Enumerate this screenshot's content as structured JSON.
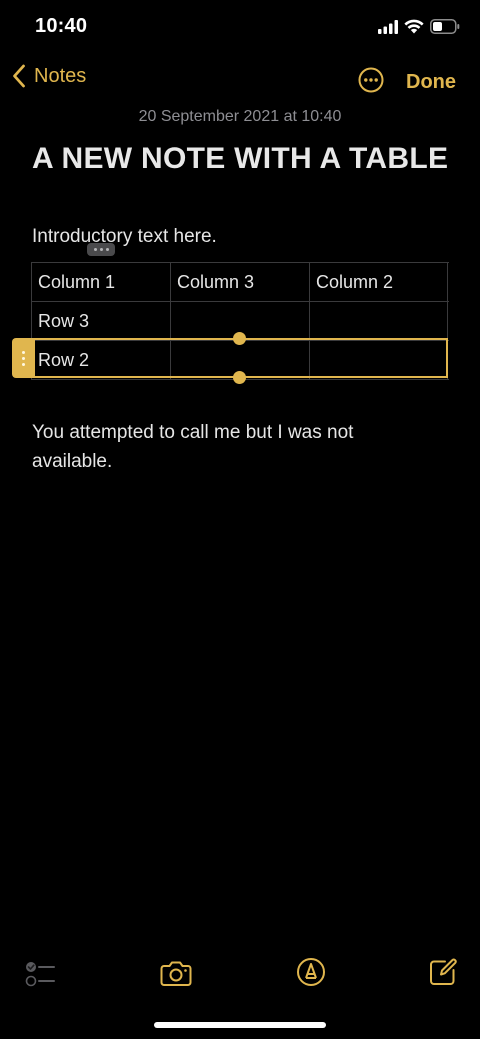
{
  "status": {
    "time": "10:40"
  },
  "nav": {
    "back_label": "Notes",
    "done_label": "Done"
  },
  "note": {
    "date": "20 September 2021 at 10:40",
    "title": "A NEW NOTE WITH A TABLE",
    "intro": "Introductory text here.",
    "body": "You attempted to call me but I was not available."
  },
  "table": {
    "rows": [
      [
        "Column 1",
        "Column 3",
        "Column 2"
      ],
      [
        "Row 3",
        "",
        ""
      ],
      [
        "Row 2",
        "",
        ""
      ]
    ],
    "selected_row": 2
  },
  "colors": {
    "accent": "#e0b64e",
    "background": "#000000",
    "text": "#e6e6e6",
    "secondary_text": "#8e8e93"
  },
  "icons": {
    "back": "chevron-left-icon",
    "more": "ellipsis-circle-icon",
    "checklist": "checklist-icon",
    "camera": "camera-icon",
    "markup": "pen-tip-circle-icon",
    "compose": "compose-icon"
  }
}
